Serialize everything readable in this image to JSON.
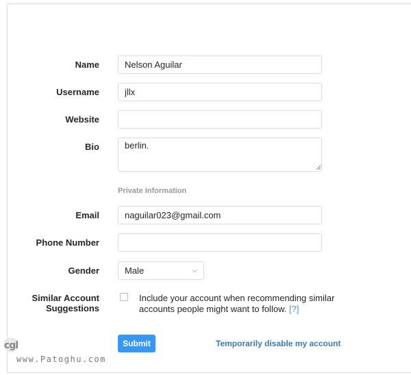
{
  "form": {
    "name": {
      "label": "Name",
      "value": "Nelson Aguilar"
    },
    "username": {
      "label": "Username",
      "value": "jllx"
    },
    "website": {
      "label": "Website",
      "value": ""
    },
    "bio": {
      "label": "Bio",
      "value": "berlin."
    },
    "private_info_title": "Private Information",
    "email": {
      "label": "Email",
      "value": "naguilar023@gmail.com"
    },
    "phone": {
      "label": "Phone Number",
      "value": ""
    },
    "gender": {
      "label": "Gender",
      "value": "Male"
    },
    "similar": {
      "label_line1": "Similar Account",
      "label_line2": "Suggestions",
      "text": "Include your account when recommending similar accounts people might want to follow.",
      "help": "[?]"
    },
    "submit_label": "Submit",
    "disable_link": "Temporarily disable my account"
  },
  "watermark": {
    "logo": "cgl̢",
    "text": "www.Patoghu.com"
  },
  "colors": {
    "accent": "#3897f0",
    "border": "#dbdbdb",
    "muted": "#999999"
  }
}
